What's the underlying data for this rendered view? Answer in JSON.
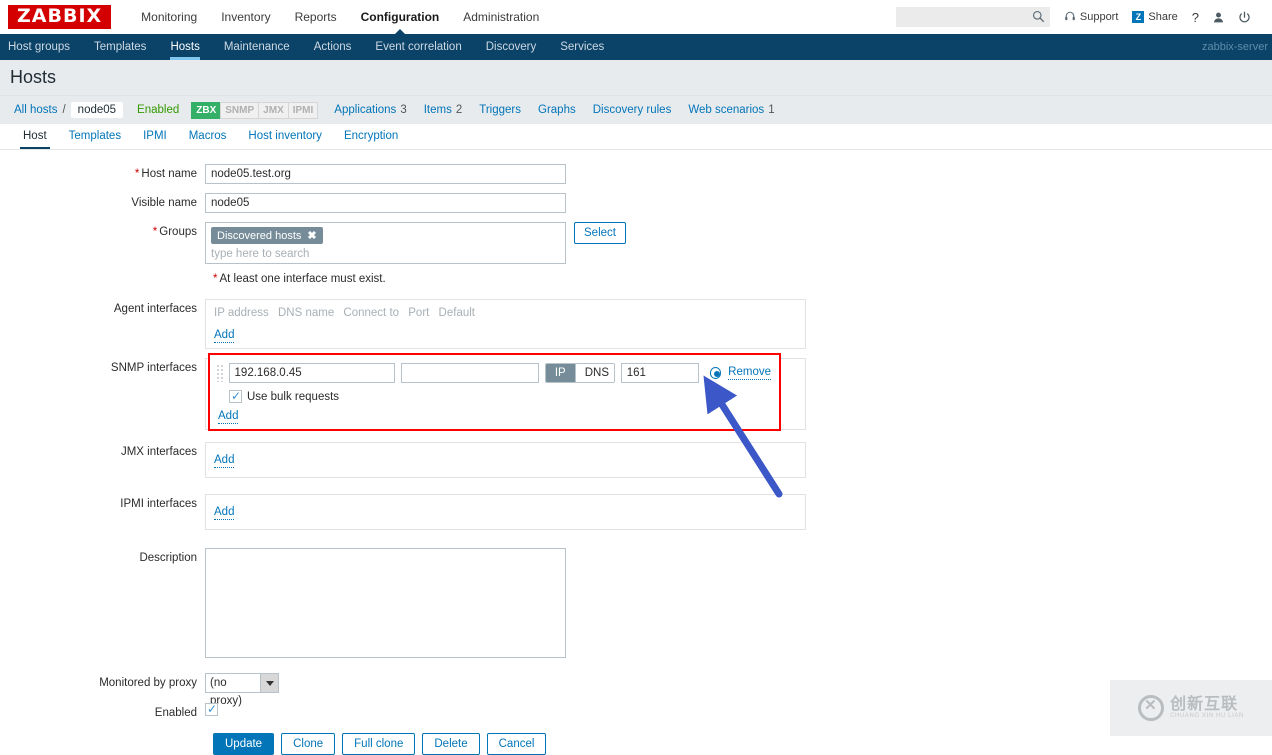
{
  "header": {
    "logo_text": "ZABBIX",
    "menu": [
      {
        "label": "Monitoring",
        "selected": false
      },
      {
        "label": "Inventory",
        "selected": false
      },
      {
        "label": "Reports",
        "selected": false
      },
      {
        "label": "Configuration",
        "selected": true
      },
      {
        "label": "Administration",
        "selected": false
      }
    ],
    "search_placeholder": "",
    "search_value": "",
    "support_label": "Support",
    "share_label": "Share",
    "share_icon_letter": "Z",
    "help_label": "?",
    "user_icon": "user-icon",
    "signout_icon": "power-icon"
  },
  "subnav": {
    "items": [
      {
        "label": "Host groups",
        "selected": false
      },
      {
        "label": "Templates",
        "selected": false
      },
      {
        "label": "Hosts",
        "selected": true
      },
      {
        "label": "Maintenance",
        "selected": false
      },
      {
        "label": "Actions",
        "selected": false
      },
      {
        "label": "Event correlation",
        "selected": false
      },
      {
        "label": "Discovery",
        "selected": false
      },
      {
        "label": "Services",
        "selected": false
      }
    ],
    "server_name": "zabbix-server"
  },
  "page": {
    "title": "Hosts"
  },
  "breadcrumb": {
    "all_hosts": "All hosts",
    "separator": "/",
    "current_host": "node05",
    "status": "Enabled",
    "badges": [
      {
        "label": "ZBX",
        "active": true
      },
      {
        "label": "SNMP",
        "active": false
      },
      {
        "label": "JMX",
        "active": false
      },
      {
        "label": "IPMI",
        "active": false
      }
    ],
    "links": [
      {
        "label": "Applications",
        "count": "3"
      },
      {
        "label": "Items",
        "count": "2"
      },
      {
        "label": "Triggers",
        "count": ""
      },
      {
        "label": "Graphs",
        "count": ""
      },
      {
        "label": "Discovery rules",
        "count": ""
      },
      {
        "label": "Web scenarios",
        "count": "1"
      }
    ]
  },
  "tabs": [
    {
      "label": "Host",
      "selected": true
    },
    {
      "label": "Templates",
      "selected": false
    },
    {
      "label": "IPMI",
      "selected": false
    },
    {
      "label": "Macros",
      "selected": false
    },
    {
      "label": "Host inventory",
      "selected": false
    },
    {
      "label": "Encryption",
      "selected": false
    }
  ],
  "form": {
    "host_name": {
      "label": "Host name",
      "required": true,
      "value": "node05.test.org"
    },
    "visible_name": {
      "label": "Visible name",
      "required": false,
      "value": "node05"
    },
    "groups": {
      "label": "Groups",
      "required": true,
      "chips": [
        "Discovered hosts"
      ],
      "chip_remove_icon": "✖",
      "placeholder": "type here to search",
      "select_button": "Select"
    },
    "interface_hint": "At least one interface must exist.",
    "agent_interfaces": {
      "label": "Agent interfaces",
      "columns": [
        "IP address",
        "DNS name",
        "Connect to",
        "Port",
        "Default"
      ],
      "add_label": "Add"
    },
    "snmp_interfaces": {
      "label": "SNMP interfaces",
      "ip": "192.168.0.45",
      "dns": "",
      "connect_to": [
        "IP",
        "DNS"
      ],
      "connect_to_selected": "IP",
      "port": "161",
      "default_selected": true,
      "remove_label": "Remove",
      "bulk_label": "Use bulk requests",
      "bulk_checked": true,
      "add_label": "Add",
      "highlight_color": "#ff0000"
    },
    "jmx_interfaces": {
      "label": "JMX interfaces",
      "add_label": "Add"
    },
    "ipmi_interfaces": {
      "label": "IPMI interfaces",
      "add_label": "Add"
    },
    "description": {
      "label": "Description",
      "value": ""
    },
    "proxy": {
      "label": "Monitored by proxy",
      "value": "(no proxy)"
    },
    "enabled": {
      "label": "Enabled",
      "checked": true
    },
    "buttons": [
      {
        "label": "Update",
        "primary": true
      },
      {
        "label": "Clone",
        "primary": false
      },
      {
        "label": "Full clone",
        "primary": false
      },
      {
        "label": "Delete",
        "primary": false
      },
      {
        "label": "Cancel",
        "primary": false
      }
    ]
  },
  "watermark": {
    "cn": "创新互联",
    "en": "CHUANG XIN HU LIAN"
  }
}
